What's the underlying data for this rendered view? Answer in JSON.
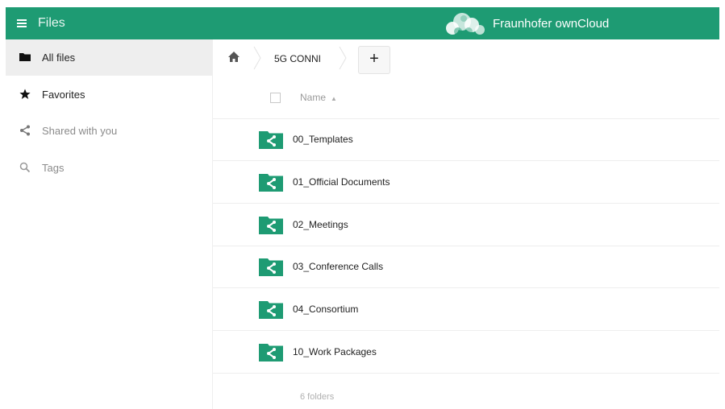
{
  "app": {
    "title": "Files",
    "brand": "Fraunhofer ownCloud"
  },
  "colors": {
    "accent": "#1e9b73",
    "active_nav": "#eeeeee"
  },
  "sidebar": {
    "items": [
      {
        "label": "All files",
        "icon": "folder-icon",
        "active": true
      },
      {
        "label": "Favorites",
        "icon": "star-icon",
        "active": false
      },
      {
        "label": "Shared with you",
        "icon": "share-icon",
        "active": false
      },
      {
        "label": "Tags",
        "icon": "search-icon",
        "active": false
      }
    ]
  },
  "breadcrumb": {
    "home_icon": "home-icon",
    "current": "5G CONNI",
    "add_label": "+"
  },
  "list": {
    "name_header": "Name",
    "sort_indicator": "▲",
    "rows": [
      {
        "name": "00_Templates",
        "icon": "shared-folder-icon"
      },
      {
        "name": "01_Official Documents",
        "icon": "shared-folder-icon"
      },
      {
        "name": "02_Meetings",
        "icon": "shared-folder-icon"
      },
      {
        "name": "03_Conference Calls",
        "icon": "shared-folder-icon"
      },
      {
        "name": "04_Consortium",
        "icon": "shared-folder-icon"
      },
      {
        "name": "10_Work Packages",
        "icon": "shared-folder-icon"
      }
    ],
    "summary": "6 folders"
  }
}
